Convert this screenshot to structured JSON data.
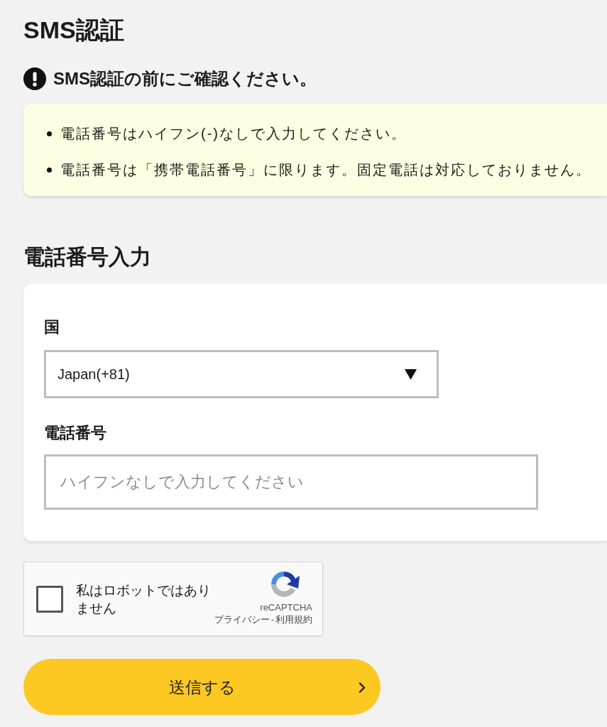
{
  "page": {
    "title": "SMS認証"
  },
  "notice": {
    "heading": "SMS認証の前にご確認ください。",
    "items": [
      "電話番号はハイフン(-)なしで入力してください。",
      "電話番号は「携帯電話番号」に限ります。固定電話は対応しておりません。"
    ]
  },
  "phone_form": {
    "heading": "電話番号入力",
    "country": {
      "label": "国",
      "value": "Japan(+81)"
    },
    "phone": {
      "label": "電話番号",
      "placeholder": "ハイフンなしで入力してください"
    }
  },
  "recaptcha": {
    "checked": false,
    "label": "私はロボットではありません",
    "brand": "reCAPTCHA",
    "links": [
      "プライバシー",
      "利用規約"
    ],
    "separator": "-"
  },
  "submit_button": {
    "label": "送信する"
  }
}
